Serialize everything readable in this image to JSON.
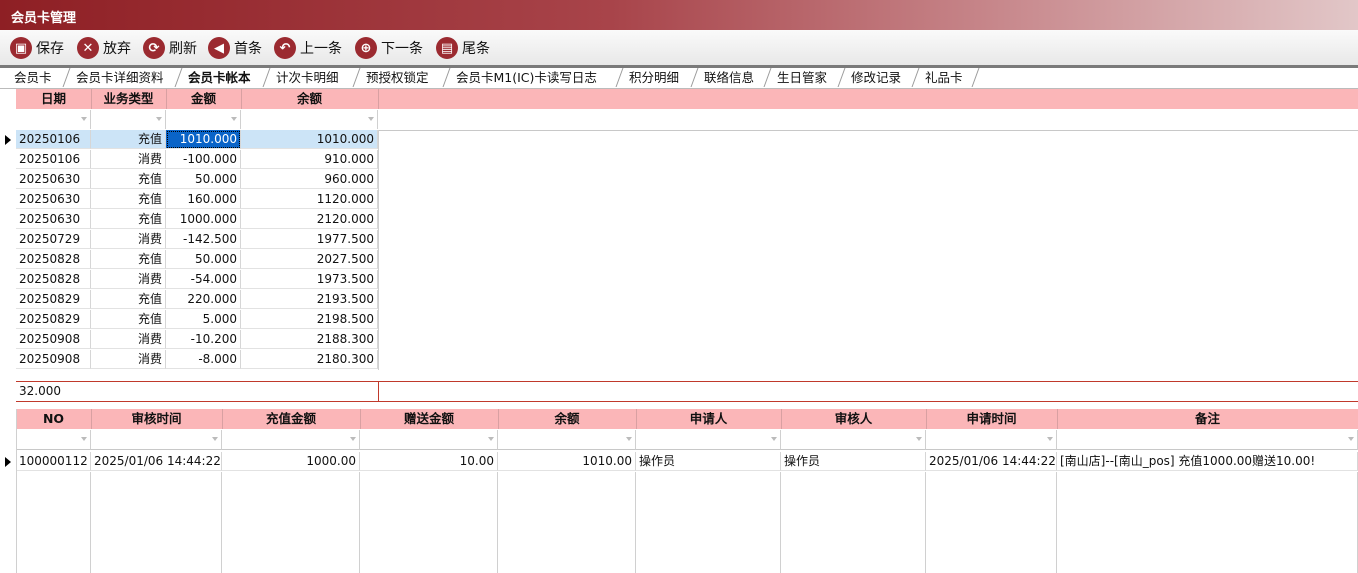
{
  "window": {
    "title": "会员卡管理"
  },
  "toolbar": [
    {
      "label": "保存",
      "icon": "save-icon",
      "glyph": "▣"
    },
    {
      "label": "放弃",
      "icon": "cancel-icon",
      "glyph": "✕"
    },
    {
      "label": "刷新",
      "icon": "refresh-icon",
      "glyph": "⟳"
    },
    {
      "label": "首条",
      "icon": "first-record-icon",
      "glyph": "◀"
    },
    {
      "label": "上一条",
      "icon": "previous-record-icon",
      "glyph": "↶"
    },
    {
      "label": "下一条",
      "icon": "next-record-icon",
      "glyph": "⊕"
    },
    {
      "label": "尾条",
      "icon": "last-record-icon",
      "glyph": "▤"
    }
  ],
  "tabs": [
    "会员卡",
    "会员卡详细资料",
    "会员卡帐本",
    "计次卡明细",
    "预授权锁定",
    "会员卡M1(IC)卡读写日志",
    "积分明细",
    "联络信息",
    "生日管家",
    "修改记录",
    "礼品卡"
  ],
  "active_tab": 2,
  "ledger": {
    "columns": [
      "日期",
      "业务类型",
      "金额",
      "余额"
    ],
    "rows": [
      [
        "20250106",
        "充值",
        "1010.000",
        "1010.000"
      ],
      [
        "20250106",
        "消费",
        "-100.000",
        "910.000"
      ],
      [
        "20250630",
        "充值",
        "50.000",
        "960.000"
      ],
      [
        "20250630",
        "充值",
        "160.000",
        "1120.000"
      ],
      [
        "20250630",
        "充值",
        "1000.000",
        "2120.000"
      ],
      [
        "20250729",
        "消费",
        "-142.500",
        "1977.500"
      ],
      [
        "20250828",
        "充值",
        "50.000",
        "2027.500"
      ],
      [
        "20250828",
        "消费",
        "-54.000",
        "1973.500"
      ],
      [
        "20250829",
        "充值",
        "220.000",
        "2193.500"
      ],
      [
        "20250829",
        "充值",
        "5.000",
        "2198.500"
      ],
      [
        "20250908",
        "消费",
        "-10.200",
        "2188.300"
      ],
      [
        "20250908",
        "消费",
        "-8.000",
        "2180.300"
      ]
    ],
    "footer": "32.000"
  },
  "detail": {
    "columns": [
      "NO",
      "审核时间",
      "充值金额",
      "赠送金额",
      "余额",
      "申请人",
      "审核人",
      "申请时间",
      "备注"
    ],
    "rows": [
      [
        "100000112",
        "2025/01/06 14:44:22",
        "1000.00",
        "10.00",
        "1010.00",
        "操作员",
        "操作员",
        "2025/01/06 14:44:22",
        "[南山店]--[南山_pos] 充值1000.00赠送10.00!"
      ]
    ]
  }
}
